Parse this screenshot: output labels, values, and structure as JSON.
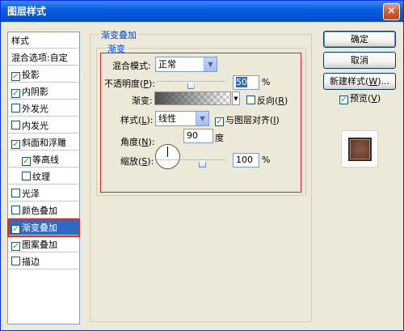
{
  "window": {
    "title": "图层样式",
    "close_glyph": "×"
  },
  "styles_list": [
    {
      "label": "样式",
      "checkbox": false,
      "checked": false,
      "indent": false,
      "selected": false
    },
    {
      "label": "混合选项:自定",
      "checkbox": false,
      "checked": false,
      "indent": false,
      "selected": false
    },
    {
      "label": "投影",
      "checkbox": true,
      "checked": true,
      "indent": false,
      "selected": false
    },
    {
      "label": "内阴影",
      "checkbox": true,
      "checked": true,
      "indent": false,
      "selected": false
    },
    {
      "label": "外发光",
      "checkbox": true,
      "checked": false,
      "indent": false,
      "selected": false
    },
    {
      "label": "内发光",
      "checkbox": true,
      "checked": false,
      "indent": false,
      "selected": false
    },
    {
      "label": "斜面和浮雕",
      "checkbox": true,
      "checked": true,
      "indent": false,
      "selected": false
    },
    {
      "label": "等高线",
      "checkbox": true,
      "checked": true,
      "indent": true,
      "selected": false
    },
    {
      "label": "纹理",
      "checkbox": true,
      "checked": false,
      "indent": true,
      "selected": false
    },
    {
      "label": "光泽",
      "checkbox": true,
      "checked": false,
      "indent": false,
      "selected": false
    },
    {
      "label": "颜色叠加",
      "checkbox": true,
      "checked": false,
      "indent": false,
      "selected": false
    },
    {
      "label": "渐变叠加",
      "checkbox": true,
      "checked": true,
      "indent": false,
      "selected": true
    },
    {
      "label": "图案叠加",
      "checkbox": true,
      "checked": true,
      "indent": false,
      "selected": false
    },
    {
      "label": "描边",
      "checkbox": true,
      "checked": false,
      "indent": false,
      "selected": false
    }
  ],
  "gradient_overlay": {
    "group_title": "渐变叠加",
    "subgroup_title": "渐变",
    "blend_mode_label": "混合模式:",
    "blend_mode_value": "正常",
    "opacity_label_pre": "不透明度(",
    "opacity_key": "P",
    "opacity_label_post": "):",
    "opacity_value": "50",
    "opacity_unit": "%",
    "opacity_fraction": 0.5,
    "gradient_label": "渐变:",
    "reverse_label_pre": "反向(",
    "reverse_key": "R",
    "reverse_label_post": ")",
    "reverse_checked": false,
    "style_label_pre": "样式(",
    "style_key": "L",
    "style_label_post": "):",
    "style_value": "线性",
    "align_label_pre": "与图层对齐(",
    "align_key": "I",
    "align_label_post": ")",
    "align_checked": true,
    "angle_label_pre": "角度(",
    "angle_key": "N",
    "angle_label_post": "):",
    "angle_value": "90",
    "angle_unit": "度",
    "scale_label_pre": "缩放(",
    "scale_key": "S",
    "scale_label_post": "):",
    "scale_value": "100",
    "scale_unit": "%",
    "scale_fraction": 0.67
  },
  "buttons": {
    "ok": "确定",
    "cancel": "取消",
    "new_style_pre": "新建样式(",
    "new_style_key": "W",
    "new_style_post": ")...",
    "preview_pre": "预览(",
    "preview_key": "V",
    "preview_post": ")",
    "preview_checked": true
  },
  "colors": {
    "title_blue": "#0550d4",
    "selection": "#316ac5",
    "highlight_red": "#d9262c",
    "check_green": "#21a121"
  }
}
